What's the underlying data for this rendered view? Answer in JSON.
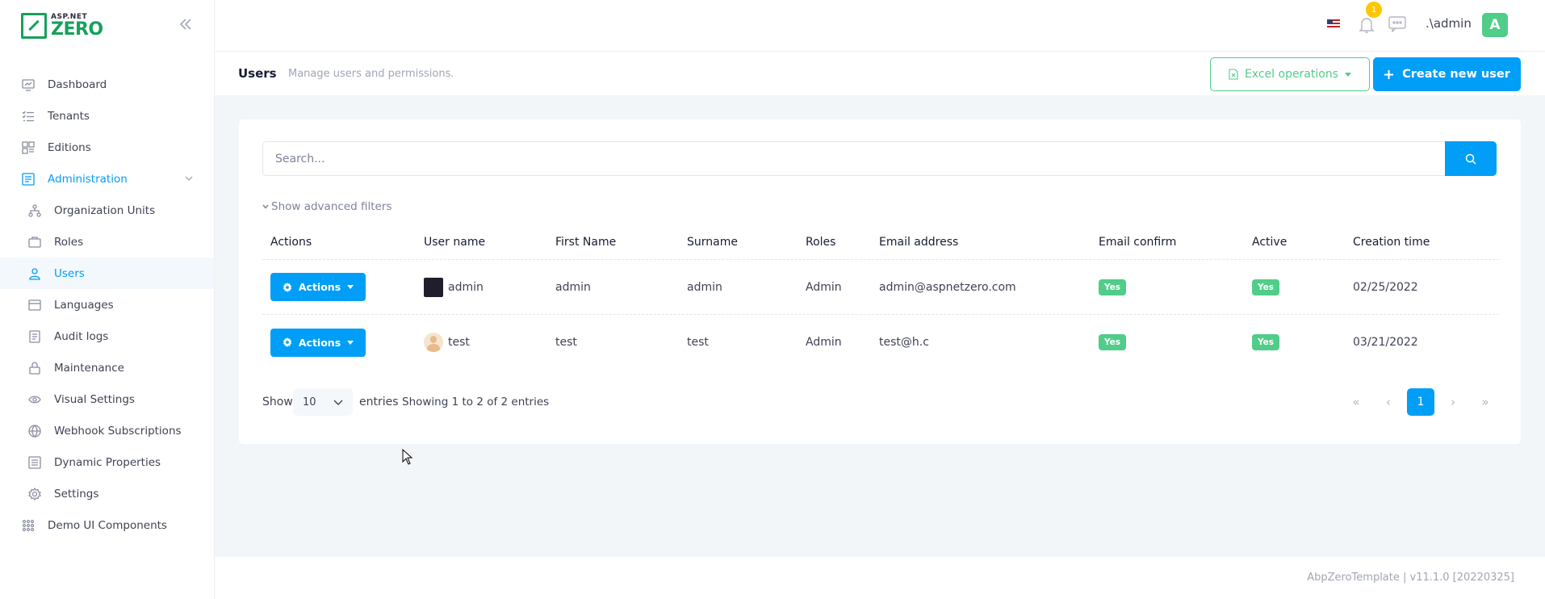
{
  "brand": {
    "small": "ASP.NET",
    "big": "ZERO"
  },
  "sidebar": {
    "items": [
      {
        "label": "Dashboard",
        "icon": "dashboard-icon"
      },
      {
        "label": "Tenants",
        "icon": "list-icon"
      },
      {
        "label": "Editions",
        "icon": "editions-icon"
      },
      {
        "label": "Administration",
        "icon": "administration-icon"
      },
      {
        "label": "Organization Units",
        "icon": "org-units-icon"
      },
      {
        "label": "Roles",
        "icon": "briefcase-icon"
      },
      {
        "label": "Users",
        "icon": "users-icon"
      },
      {
        "label": "Languages",
        "icon": "languages-icon"
      },
      {
        "label": "Audit logs",
        "icon": "audit-icon"
      },
      {
        "label": "Maintenance",
        "icon": "lock-icon"
      },
      {
        "label": "Visual Settings",
        "icon": "eye-icon"
      },
      {
        "label": "Webhook Subscriptions",
        "icon": "globe-icon"
      },
      {
        "label": "Dynamic Properties",
        "icon": "properties-icon"
      },
      {
        "label": "Settings",
        "icon": "gear-icon"
      },
      {
        "label": "Demo UI Components",
        "icon": "grid-icon"
      }
    ],
    "active": "Users"
  },
  "header": {
    "notification_count": "1",
    "user_name": ".\\admin",
    "avatar_letter": "A"
  },
  "subheader": {
    "title": "Users",
    "description": "Manage users and permissions.",
    "excel_label": "Excel operations",
    "create_label": "Create new user"
  },
  "search": {
    "placeholder": "Search...",
    "advanced_filters": "Show advanced filters"
  },
  "table": {
    "columns": [
      "Actions",
      "User name",
      "First Name",
      "Surname",
      "Roles",
      "Email address",
      "Email confirm",
      "Active",
      "Creation time"
    ],
    "rows": [
      {
        "actions": "Actions",
        "user_name": "admin",
        "first_name": "admin",
        "surname": "admin",
        "roles": "Admin",
        "email": "admin@aspnetzero.com",
        "email_confirm": "Yes",
        "active": "Yes",
        "created": "02/25/2022"
      },
      {
        "actions": "Actions",
        "user_name": "test",
        "first_name": "test",
        "surname": "test",
        "roles": "Admin",
        "email": "test@h.c",
        "email_confirm": "Yes",
        "active": "Yes",
        "created": "03/21/2022"
      }
    ]
  },
  "paging": {
    "show_label": "Show",
    "page_size": "10",
    "entries_label": "entries",
    "summary": "Showing 1 to 2 of 2 entries",
    "first": "«",
    "prev": "‹",
    "current": "1",
    "next": "›",
    "last": "»"
  },
  "footer": {
    "version": "AbpZeroTemplate | v11.1.0 [20220325]"
  },
  "colors": {
    "primary": "#009ef7",
    "success": "#50cd89",
    "warning": "#ffc700",
    "brand_green": "#17a05d"
  }
}
